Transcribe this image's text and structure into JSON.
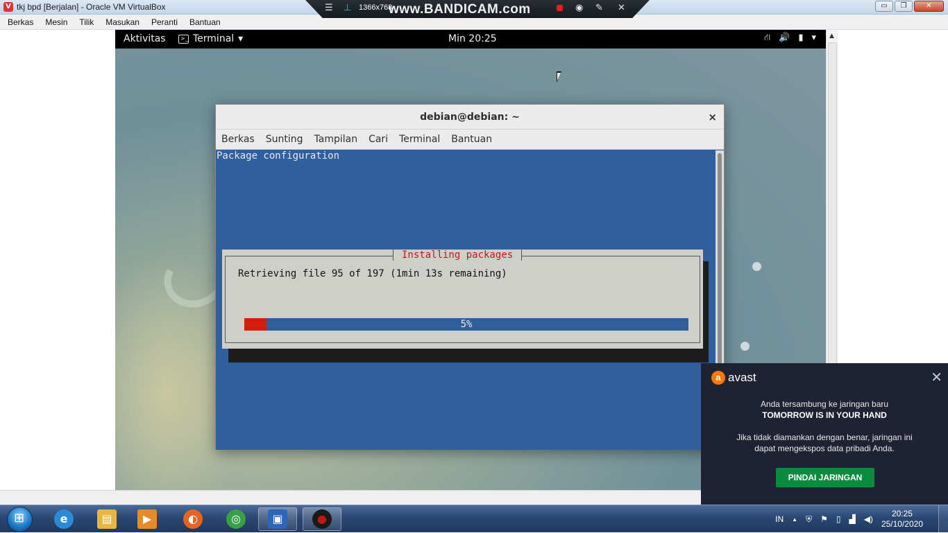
{
  "vbox": {
    "title": "tkj bpd [Berjalan] - Oracle VM VirtualBox",
    "title_icon": "virtualbox-icon",
    "controls": {
      "minimize": "▭",
      "maximize": "❐",
      "close": "✕"
    },
    "menu": [
      "Berkas",
      "Mesin",
      "Tilik",
      "Masukan",
      "Peranti",
      "Bantuan"
    ]
  },
  "bandicam": {
    "resolution": "1366x768",
    "logo": "www.BANDICAM.com",
    "icons": {
      "menu": "☰",
      "pin": "⊥",
      "camera": "◉",
      "pencil": "✎",
      "close": "✕"
    }
  },
  "gnome": {
    "activities": "Aktivitas",
    "app_menu": "Terminal",
    "app_menu_arrow": "▾",
    "clock": "Min 20:25",
    "status_icons": {
      "network": "⛙",
      "volume": "🔊",
      "battery": "▮",
      "menu_arrow": "▾"
    }
  },
  "terminal": {
    "title": "debian@debian: ~",
    "close": "×",
    "menu": [
      "Berkas",
      "Sunting",
      "Tampilan",
      "Cari",
      "Terminal",
      "Bantuan"
    ],
    "header_text": "Package configuration",
    "dialog": {
      "title": "Installing packages",
      "message": "Retrieving file 95 of 197 (1min 13s remaining)",
      "progress_percent": 5,
      "progress_label": "5%"
    }
  },
  "avast": {
    "brand": "avast",
    "close": "✕",
    "line1": "Anda tersambung ke jaringan baru",
    "network_name": "TOMORROW IS IN YOUR HAND",
    "line2": "Jika tidak diamankan dengan benar, jaringan ini",
    "line3": "dapat mengekspos data pribadi Anda.",
    "button": "PINDAI JARINGAN",
    "colors": {
      "background": "#1e2233",
      "button": "#0a8b3f",
      "brand": "#ff7800"
    }
  },
  "taskbar": {
    "apps": [
      {
        "name": "internet-explorer-icon",
        "glyph": "e",
        "color": "#2a8ad8"
      },
      {
        "name": "file-explorer-icon",
        "glyph": "▤",
        "color": "#e8b640"
      },
      {
        "name": "media-player-icon",
        "glyph": "▶",
        "color": "#e88a2a"
      },
      {
        "name": "firefox-icon",
        "glyph": "◐",
        "color": "#e8631e"
      },
      {
        "name": "chrome-icon",
        "glyph": "◎",
        "color": "#3aa047"
      },
      {
        "name": "virtualbox-icon",
        "glyph": "▣",
        "color": "#2c66b8"
      },
      {
        "name": "bandicam-icon",
        "glyph": "●",
        "color": "#c01818"
      }
    ],
    "tray": {
      "language": "IN",
      "show_hidden": "▲",
      "security": "⛨",
      "flag": "⚑",
      "battery": "▯",
      "signal": "▟",
      "volume": "◀)"
    },
    "clock_time": "20:25",
    "clock_date": "25/10/2020"
  }
}
